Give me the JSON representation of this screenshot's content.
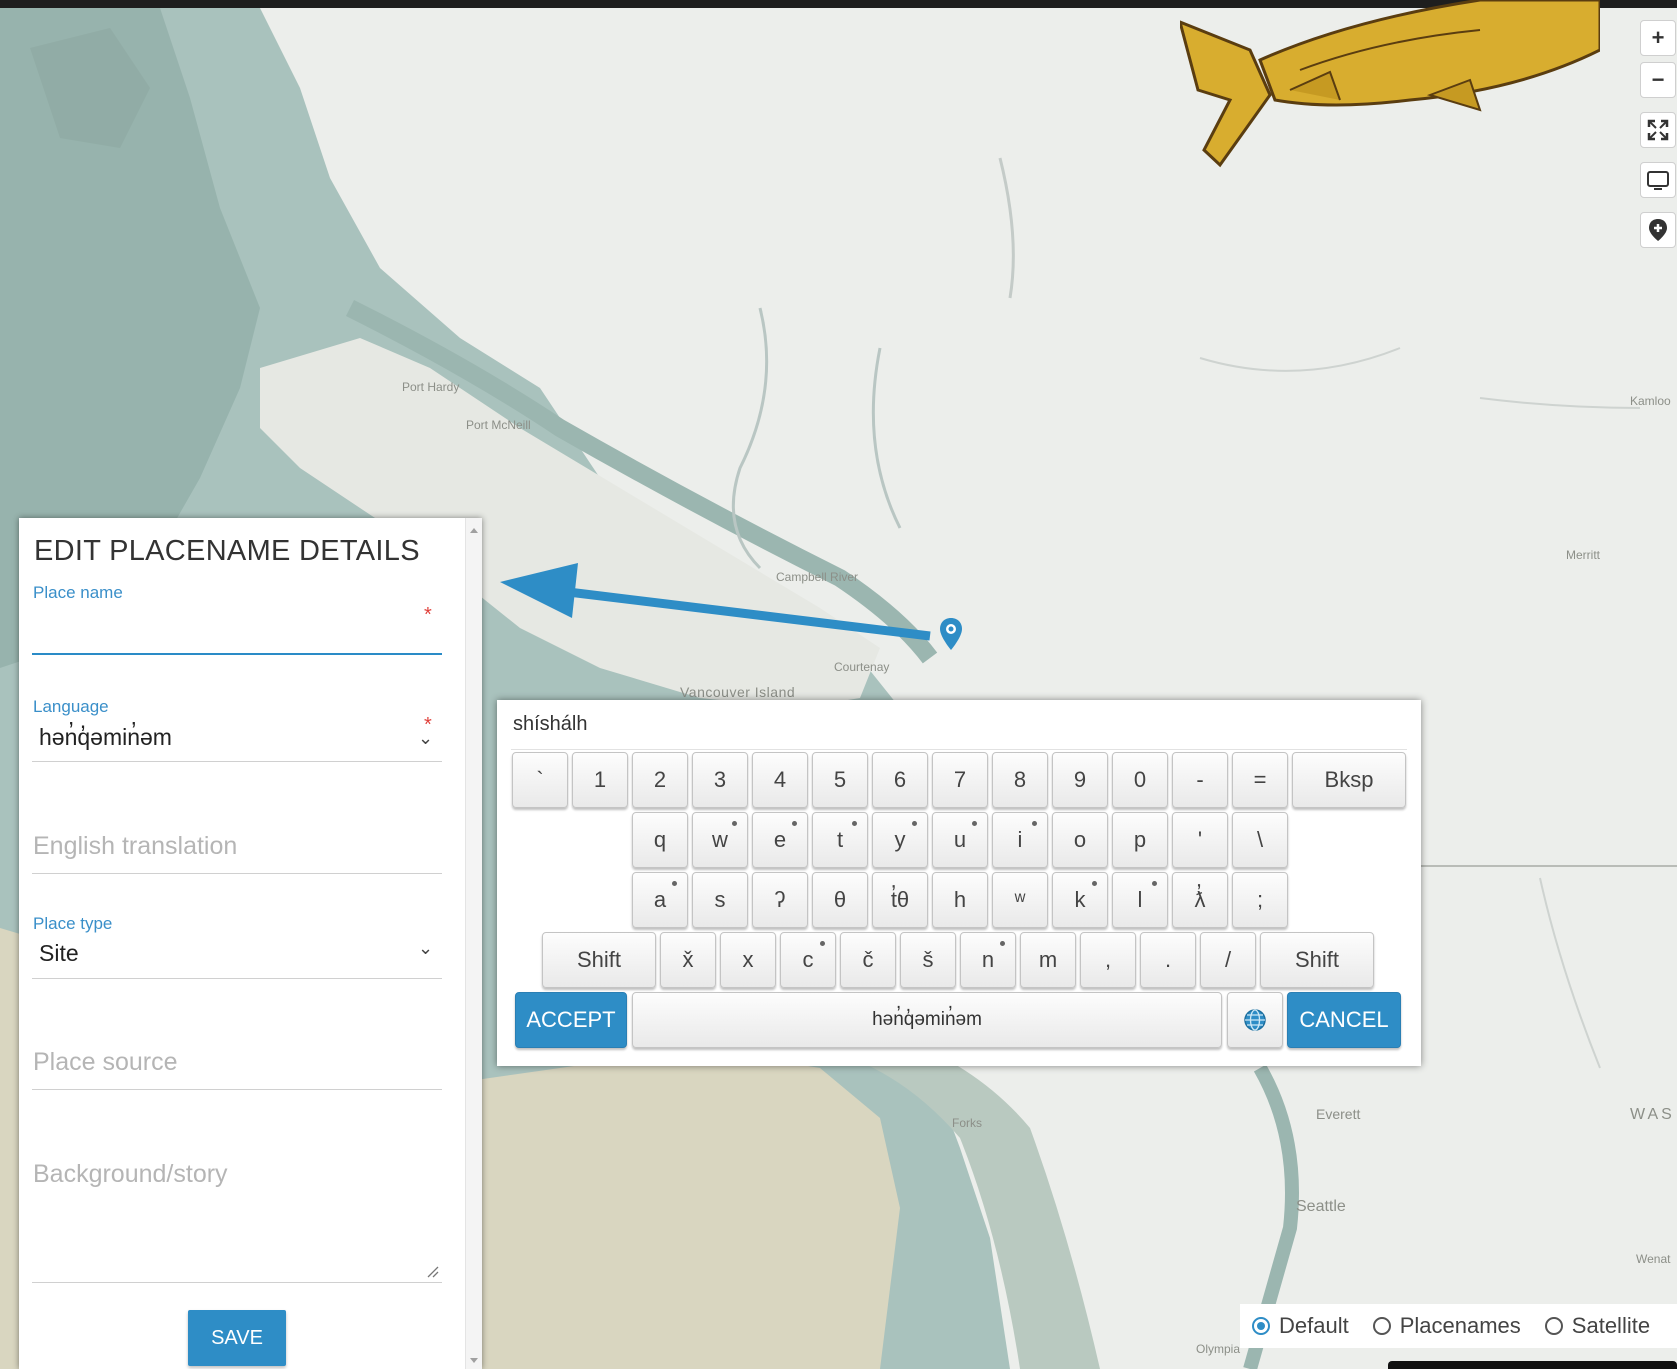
{
  "map": {
    "labels": {
      "port_hardy": "Port Hardy",
      "port_mcneill": "Port McNeill",
      "campbell_river": "Campbell River",
      "courtenay": "Courtenay",
      "vancouver_island": "Vancouver Island",
      "kamloops": "Kamloo",
      "merritt": "Merritt",
      "forks": "Forks",
      "everett": "Everett",
      "seattle": "Seattle",
      "wash": "WAS",
      "wenatchee": "Wenat",
      "olympia": "Olympia"
    },
    "controls": {
      "zoom_in": "+",
      "zoom_out": "−",
      "fullscreen_icon": "expand-icon",
      "screen_icon": "monitor-icon",
      "add_marker_icon": "add-location-icon"
    },
    "colors": {
      "water": "#a9c2bd",
      "land": "#eceeeb",
      "accent": "#2e8dc6"
    }
  },
  "panel": {
    "title": "EDIT PLACENAME DETAILS",
    "place_name": {
      "label": "Place name",
      "value": "",
      "required": "*"
    },
    "language": {
      "label": "Language",
      "value": "hən̓q̓əmin̓əm",
      "required": "*"
    },
    "english_translation": {
      "placeholder": "English translation"
    },
    "place_type": {
      "label": "Place type",
      "value": "Site"
    },
    "place_source": {
      "placeholder": "Place source"
    },
    "background": {
      "placeholder": "Background/story"
    },
    "save": "SAVE"
  },
  "keyboard": {
    "title": "shíshálh",
    "row1": [
      "`",
      "1",
      "2",
      "3",
      "4",
      "5",
      "6",
      "7",
      "8",
      "9",
      "0",
      "-",
      "=",
      "Bksp"
    ],
    "row2": [
      "q",
      "w",
      "e",
      "t",
      "y",
      "u",
      "i",
      "o",
      "p",
      "'",
      "\\"
    ],
    "row3": [
      "a",
      "s",
      "ʔ",
      "θ",
      "t̓θ",
      "h",
      "ʷ",
      "k",
      "l",
      "ƛ̓",
      ";"
    ],
    "row4": [
      "Shift",
      "x̌",
      "x",
      "c",
      "č",
      "š",
      "n",
      "m",
      ",",
      ".",
      "/",
      "Shift"
    ],
    "accept": "ACCEPT",
    "space": "hən̓q̓əmin̓əm",
    "cancel": "CANCEL"
  },
  "layers": {
    "options": [
      "Default",
      "Placenames",
      "Satellite"
    ],
    "selected": "Default"
  }
}
